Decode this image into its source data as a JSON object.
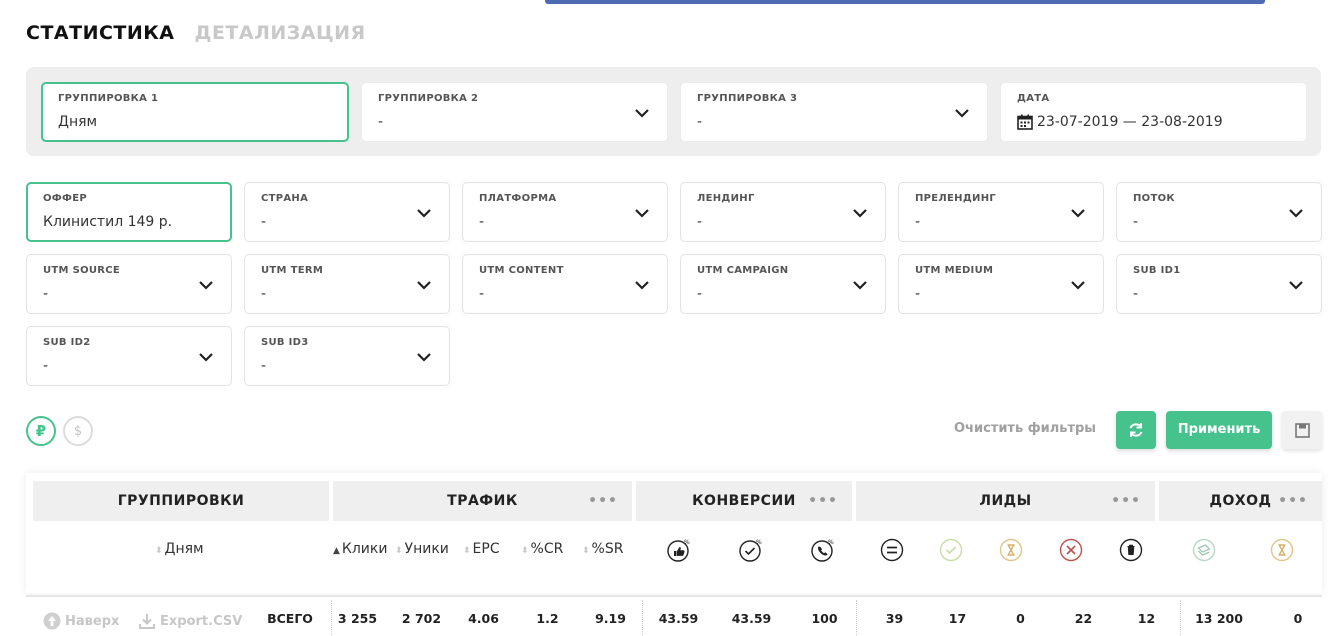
{
  "tabs": {
    "active": "СТАТИСТИКА",
    "inactive": "ДЕТАЛИЗАЦИЯ"
  },
  "grouping": [
    {
      "label": "ГРУППИРОВКА 1",
      "value": "Дням"
    },
    {
      "label": "ГРУППИРОВКА 2",
      "value": "-"
    },
    {
      "label": "ГРУППИРОВКА 3",
      "value": "-"
    },
    {
      "label": "ДАТА",
      "value": "23-07-2019 — 23-08-2019"
    }
  ],
  "filters": [
    {
      "label": "ОФФЕР",
      "value": "Клинистил 149 р."
    },
    {
      "label": "СТРАНА",
      "value": "-"
    },
    {
      "label": "ПЛАТФОРМА",
      "value": "-"
    },
    {
      "label": "ЛЕНДИНГ",
      "value": "-"
    },
    {
      "label": "ПРЕЛЕНДИНГ",
      "value": "-"
    },
    {
      "label": "ПОТОК",
      "value": "-"
    },
    {
      "label": "UTM SOURCE",
      "value": "-"
    },
    {
      "label": "UTM TERM",
      "value": "-"
    },
    {
      "label": "UTM CONTENT",
      "value": "-"
    },
    {
      "label": "UTM CAMPAIGN",
      "value": "-"
    },
    {
      "label": "UTM MEDIUM",
      "value": "-"
    },
    {
      "label": "SUB ID1",
      "value": "-"
    },
    {
      "label": "SUB ID2",
      "value": "-"
    },
    {
      "label": "SUB ID3",
      "value": "-"
    }
  ],
  "currency": {
    "rub": "₽",
    "usd": "$"
  },
  "actions": {
    "clear": "Очистить фильтры",
    "apply": "Применить"
  },
  "table": {
    "groups": [
      "ГРУППИРОВКИ",
      "ТРАФИК",
      "КОНВЕРСИИ",
      "ЛИДЫ",
      "ДОХОД"
    ],
    "more": "•••",
    "subheaders": [
      "Дням",
      "Клики",
      "Уники",
      "EPC",
      "%CR",
      "%SR"
    ],
    "icons": [
      "thumbs-up-percent-icon",
      "check-percent-icon",
      "phone-percent-icon",
      "equals-circle-icon",
      "check-circle-icon",
      "hourglass-icon",
      "x-circle-icon",
      "trash-circle-icon",
      "money-icon",
      "hourglass-icon"
    ]
  },
  "footer": {
    "up": "Наверх",
    "export": "Export.CSV",
    "total_label": "ВСЕГО",
    "totals": [
      "3 255",
      "2 702",
      "4.06",
      "1.2",
      "9.19",
      "43.59",
      "43.59",
      "100",
      "39",
      "17",
      "0",
      "22",
      "12",
      "13 200",
      "0"
    ]
  },
  "colors": {
    "accent": "#46c28d",
    "topbar": "#4e6ab2"
  }
}
